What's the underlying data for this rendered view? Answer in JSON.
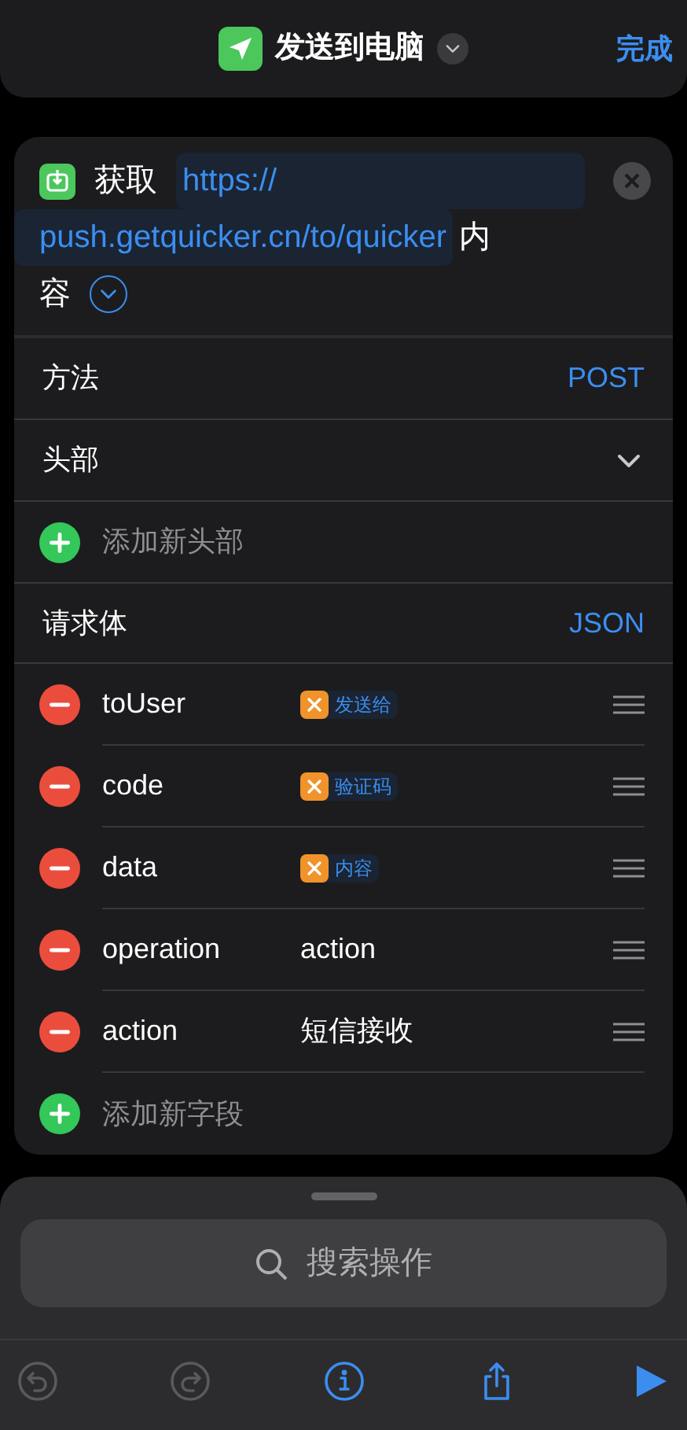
{
  "nav": {
    "title": "发送到电脑",
    "done": "完成"
  },
  "action": {
    "verb": "获取",
    "url_part1": "https://",
    "url_part2": "push.getquicker.cn/to/quicker",
    "tail_part1": "内",
    "tail_part2": "容",
    "expanded": false
  },
  "method": {
    "label": "方法",
    "value": "POST"
  },
  "headers": {
    "label": "头部",
    "expanded": false,
    "add_label": "添加新头部"
  },
  "body": {
    "label": "请求体",
    "value": "JSON"
  },
  "fields": [
    {
      "key": "toUser",
      "kind": "variable",
      "value": "发送给"
    },
    {
      "key": "code",
      "kind": "variable",
      "value": "验证码"
    },
    {
      "key": "data",
      "kind": "variable",
      "value": "内容"
    },
    {
      "key": "operation",
      "kind": "text",
      "value": "action"
    },
    {
      "key": "action",
      "kind": "text",
      "value": "短信接收"
    }
  ],
  "add_field": "添加新字段",
  "search": {
    "placeholder": "搜索操作"
  },
  "toolbar": [
    {
      "kind": "undo",
      "disabled": true
    },
    {
      "kind": "redo",
      "disabled": true
    },
    {
      "kind": "info",
      "disabled": false
    },
    {
      "kind": "share",
      "disabled": false
    },
    {
      "kind": "run",
      "disabled": false
    }
  ]
}
